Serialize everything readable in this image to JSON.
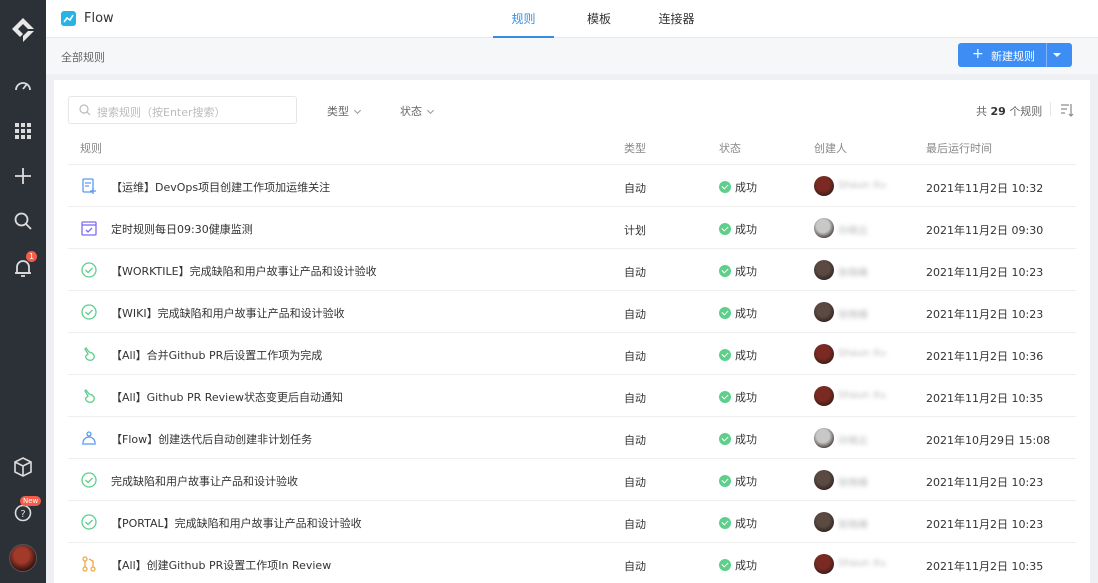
{
  "app": {
    "name": "Flow",
    "logo_color": "#27b4e4",
    "accent_color": "#3d8df5"
  },
  "tabs": [
    {
      "label": "规则",
      "active": true
    },
    {
      "label": "模板",
      "active": false
    },
    {
      "label": "连接器",
      "active": false
    }
  ],
  "sidebar": {
    "icons": [
      "logo-icon",
      "dashboard-icon",
      "apps-grid-icon",
      "plus-icon",
      "search-icon",
      "bell-icon",
      "cube-icon",
      "help-icon",
      "avatar"
    ],
    "notification_badge": "1",
    "help_new_tag": "New"
  },
  "breadcrumb": "全部规则",
  "new_rule_button": {
    "label": "新建规则",
    "plus": "+"
  },
  "toolbar": {
    "search_placeholder": "搜索规则（按Enter搜索）",
    "filter_type": "类型",
    "filter_status": "状态",
    "count_prefix": "共",
    "count_value": "29",
    "count_suffix": "个规则"
  },
  "table": {
    "headers": {
      "rule": "规则",
      "type": "类型",
      "status": "状态",
      "creator": "创建人",
      "last_run": "最后运行时间"
    },
    "rows": [
      {
        "icon": "task-add-icon",
        "icon_color": "#5b9bf0",
        "name": "【运维】DevOps项目创建工作项加运维关注",
        "type": "自动",
        "status": "成功",
        "creator": "Shaun Xu",
        "avatar_color": "#7a2a22",
        "last_run": "2021年11月2日 10:32"
      },
      {
        "icon": "calendar-check-icon",
        "icon_color": "#7b6cf0",
        "name": "定时规则每日09:30健康监测",
        "type": "计划",
        "status": "成功",
        "creator": "孙晓云",
        "avatar_color": "#c8c8c8",
        "last_run": "2021年11月2日 09:30"
      },
      {
        "icon": "check-circle-icon",
        "icon_color": "#5dcf8b",
        "name": "【WORKTILE】完成缺陷和用户故事让产品和设计验收",
        "type": "自动",
        "status": "成功",
        "creator": "张晓峰",
        "avatar_color": "#5a4a42",
        "last_run": "2021年11月2日 10:23"
      },
      {
        "icon": "check-circle-icon",
        "icon_color": "#5dcf8b",
        "name": "【WIKI】完成缺陷和用户故事让产品和设计验收",
        "type": "自动",
        "status": "成功",
        "creator": "张晓峰",
        "avatar_color": "#5a4a42",
        "last_run": "2021年11月2日 10:23"
      },
      {
        "icon": "hand-icon",
        "icon_color": "#5dcf8b",
        "name": "【All】合并Github PR后设置工作项为完成",
        "type": "自动",
        "status": "成功",
        "creator": "Shaun Xu",
        "avatar_color": "#7a2a22",
        "last_run": "2021年11月2日 10:36"
      },
      {
        "icon": "hand-icon",
        "icon_color": "#5dcf8b",
        "name": "【All】Github PR Review状态变更后自动通知",
        "type": "自动",
        "status": "成功",
        "creator": "Shaun Xu",
        "avatar_color": "#7a2a22",
        "last_run": "2021年11月2日 10:35"
      },
      {
        "icon": "iteration-icon",
        "icon_color": "#5b9bf0",
        "name": "【Flow】创建迭代后自动创建非计划任务",
        "type": "自动",
        "status": "成功",
        "creator": "孙晓云",
        "avatar_color": "#c8c8c8",
        "last_run": "2021年10月29日 15:08"
      },
      {
        "icon": "check-circle-icon",
        "icon_color": "#5dcf8b",
        "name": "完成缺陷和用户故事让产品和设计验收",
        "type": "自动",
        "status": "成功",
        "creator": "张晓峰",
        "avatar_color": "#5a4a42",
        "last_run": "2021年11月2日 10:23"
      },
      {
        "icon": "check-circle-icon",
        "icon_color": "#5dcf8b",
        "name": "【PORTAL】完成缺陷和用户故事让产品和设计验收",
        "type": "自动",
        "status": "成功",
        "creator": "张晓峰",
        "avatar_color": "#5a4a42",
        "last_run": "2021年11月2日 10:23"
      },
      {
        "icon": "pull-request-icon",
        "icon_color": "#f0a84a",
        "name": "【All】创建Github PR设置工作项In Review",
        "type": "自动",
        "status": "成功",
        "creator": "Shaun Xu",
        "avatar_color": "#7a2a22",
        "last_run": "2021年11月2日 10:35"
      }
    ]
  }
}
